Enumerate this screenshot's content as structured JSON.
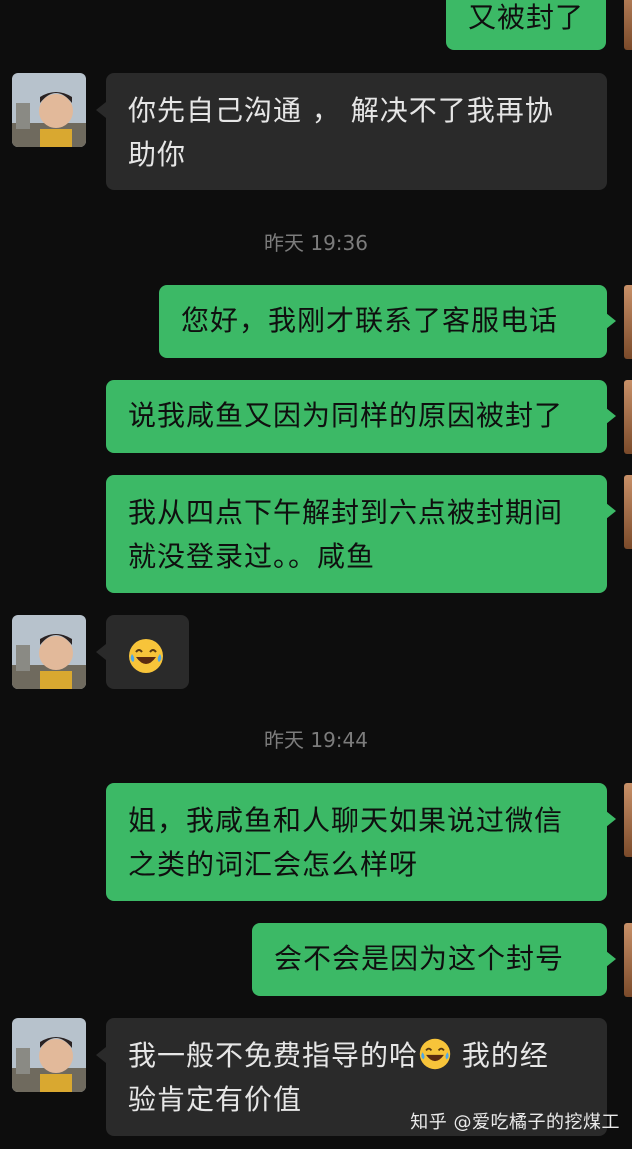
{
  "messages": [
    {
      "side": "out",
      "text": "又被封了"
    },
    {
      "side": "in",
      "line1": "你先自己沟通 ， 解决不了我再协",
      "line2": "助你"
    },
    {
      "side": "out",
      "text": "您好，我刚才联系了客服电话"
    },
    {
      "side": "out",
      "text": "说我咸鱼又因为同样的原因被封了"
    },
    {
      "side": "out",
      "line1": "我从四点下午解封到六点被封期间",
      "line2": "就没登录过。。咸鱼"
    },
    {
      "side": "in",
      "emoji": "tears-of-joy-emoji"
    },
    {
      "side": "out",
      "line1": "姐，我咸鱼和人聊天如果说过微信",
      "line2": "之类的词汇会怎么样呀"
    },
    {
      "side": "out",
      "text": "会不会是因为这个封号"
    },
    {
      "side": "in",
      "line1a": "我一般不免费指导的哈",
      "line1b": " 我的经",
      "line2": "验肯定有价值"
    }
  ],
  "timestamps": [
    "昨天 19:36",
    "昨天 19:44"
  ],
  "watermark": "知乎 @爱吃橘子的挖煤工",
  "colors": {
    "background": "#0d0d0d",
    "outgoing_bubble": "#3cb966",
    "incoming_bubble": "#2a2a2a",
    "timestamp": "#7c7c7c"
  }
}
